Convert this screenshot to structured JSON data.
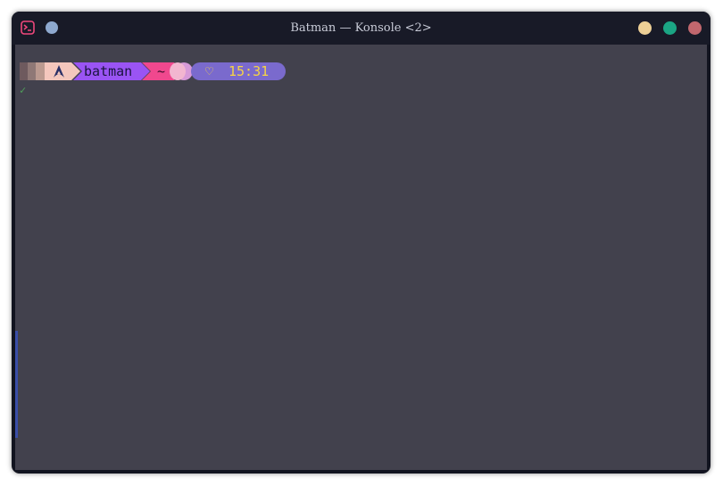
{
  "window": {
    "title": "Batman — Konsole <2>"
  },
  "prompt": {
    "os_icon": "arch-linux-icon",
    "user": "batman",
    "dir": "~",
    "heart": "♡",
    "time": "15:31"
  },
  "status": {
    "check": "✓"
  },
  "colors": {
    "window_bg": "#121420",
    "terminal_bg": "#42414d",
    "user_segment": "#9a54f4",
    "dir_segment": "#f0488e",
    "time_segment": "#7a6acd",
    "time_text": "#f6d444",
    "check": "#4fa05a"
  }
}
